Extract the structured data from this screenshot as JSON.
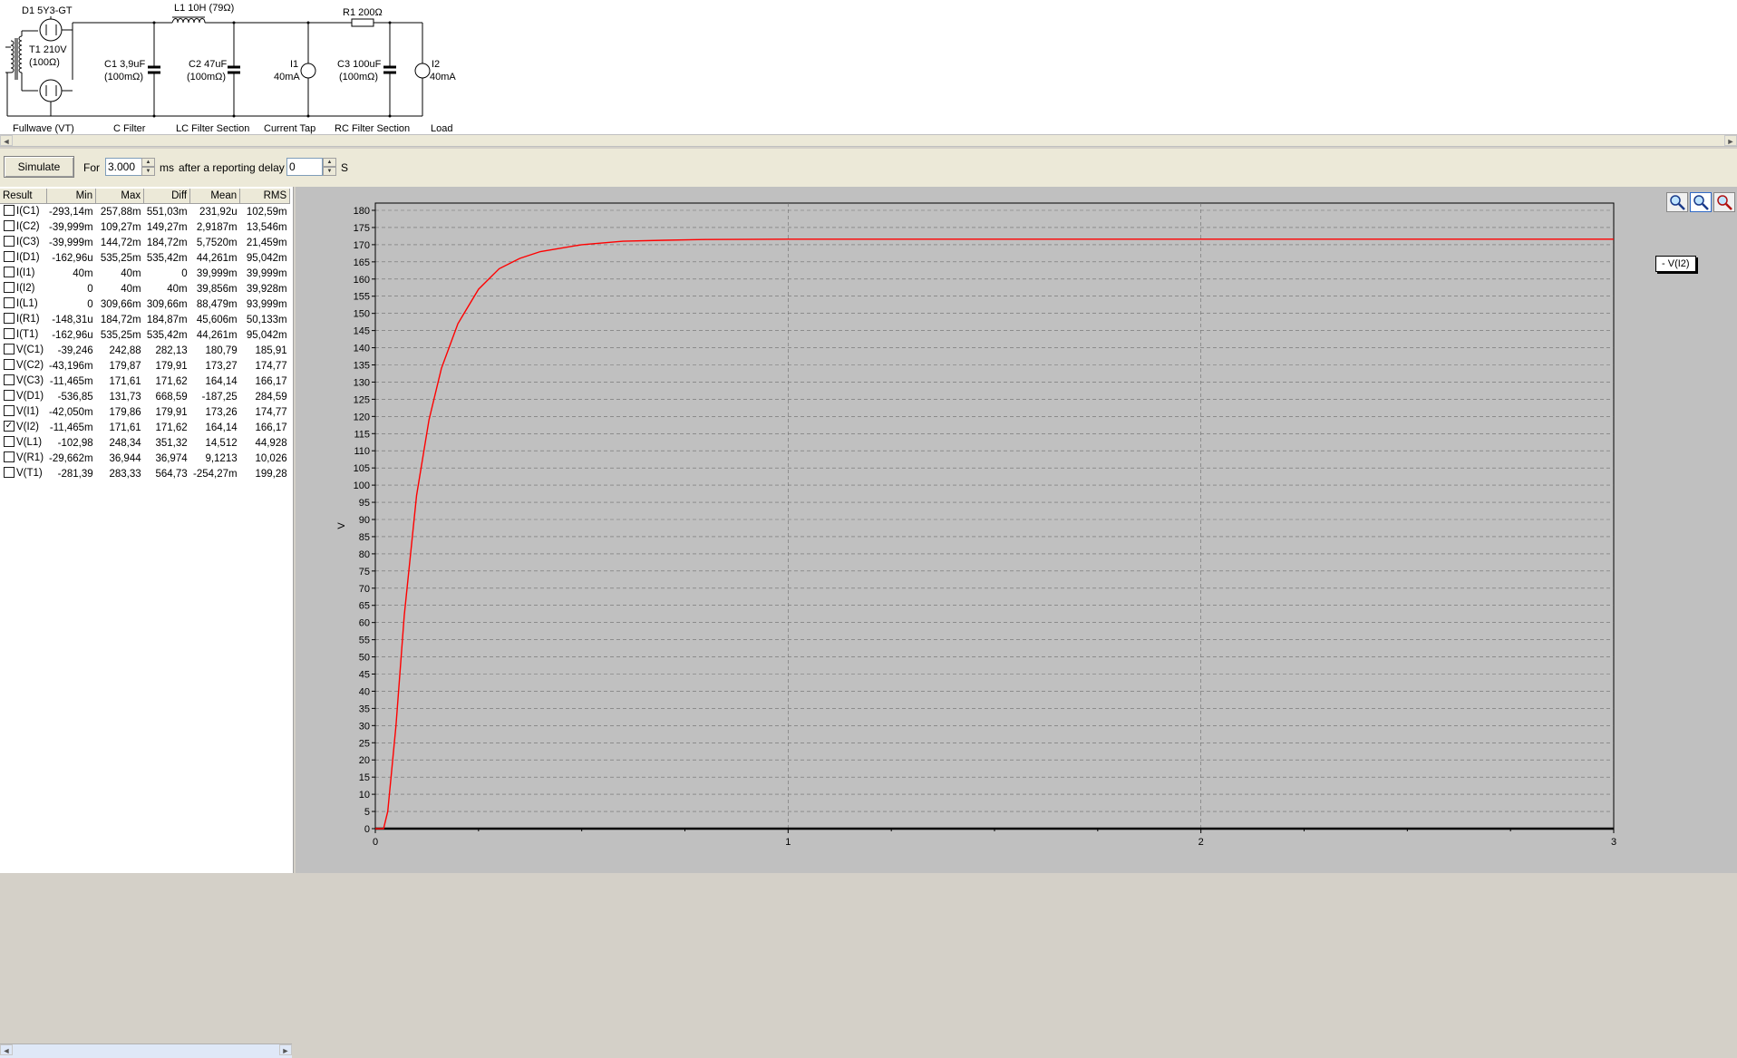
{
  "schematic": {
    "components": {
      "d1": "D1 5Y3-GT",
      "t1_line1": "T1 210V",
      "t1_line2": "(100Ω)",
      "l1": "L1 10H (79Ω)",
      "r1": "R1 200Ω",
      "c1_line1": "C1 3,9uF",
      "c1_line2": "(100mΩ)",
      "c2_line1": "C2 47uF",
      "c2_line2": "(100mΩ)",
      "i1_line1": "I1",
      "i1_line2": "40mA",
      "c3_line1": "C3 100uF",
      "c3_line2": "(100mΩ)",
      "i2_line1": "I2",
      "i2_line2": "40mA"
    },
    "sections": [
      "Fullwave (VT)",
      "C Filter",
      "LC Filter Section",
      "Current Tap",
      "RC Filter Section",
      "Load"
    ]
  },
  "toolbar": {
    "simulate_label": "Simulate",
    "for_label": "For",
    "duration_value": "3.000",
    "duration_unit": "ms",
    "delay_label": "after a reporting delay of",
    "delay_value": "0",
    "delay_unit": "S"
  },
  "results": {
    "headers": [
      "Result",
      "Min",
      "Max",
      "Diff",
      "Mean",
      "RMS"
    ],
    "rows": [
      {
        "name": "I(C1)",
        "checked": false,
        "min": "-293,14m",
        "max": "257,88m",
        "diff": "551,03m",
        "mean": "231,92u",
        "rms": "102,59m"
      },
      {
        "name": "I(C2)",
        "checked": false,
        "min": "-39,999m",
        "max": "109,27m",
        "diff": "149,27m",
        "mean": "2,9187m",
        "rms": "13,546m"
      },
      {
        "name": "I(C3)",
        "checked": false,
        "min": "-39,999m",
        "max": "144,72m",
        "diff": "184,72m",
        "mean": "5,7520m",
        "rms": "21,459m"
      },
      {
        "name": "I(D1)",
        "checked": false,
        "min": "-162,96u",
        "max": "535,25m",
        "diff": "535,42m",
        "mean": "44,261m",
        "rms": "95,042m"
      },
      {
        "name": "I(I1)",
        "checked": false,
        "min": "40m",
        "max": "40m",
        "diff": "0",
        "mean": "39,999m",
        "rms": "39,999m"
      },
      {
        "name": "I(I2)",
        "checked": false,
        "min": "0",
        "max": "40m",
        "diff": "40m",
        "mean": "39,856m",
        "rms": "39,928m"
      },
      {
        "name": "I(L1)",
        "checked": false,
        "min": "0",
        "max": "309,66m",
        "diff": "309,66m",
        "mean": "88,479m",
        "rms": "93,999m"
      },
      {
        "name": "I(R1)",
        "checked": false,
        "min": "-148,31u",
        "max": "184,72m",
        "diff": "184,87m",
        "mean": "45,606m",
        "rms": "50,133m"
      },
      {
        "name": "I(T1)",
        "checked": false,
        "min": "-162,96u",
        "max": "535,25m",
        "diff": "535,42m",
        "mean": "44,261m",
        "rms": "95,042m"
      },
      {
        "name": "V(C1)",
        "checked": false,
        "min": "-39,246",
        "max": "242,88",
        "diff": "282,13",
        "mean": "180,79",
        "rms": "185,91"
      },
      {
        "name": "V(C2)",
        "checked": false,
        "min": "-43,196m",
        "max": "179,87",
        "diff": "179,91",
        "mean": "173,27",
        "rms": "174,77"
      },
      {
        "name": "V(C3)",
        "checked": false,
        "min": "-11,465m",
        "max": "171,61",
        "diff": "171,62",
        "mean": "164,14",
        "rms": "166,17"
      },
      {
        "name": "V(D1)",
        "checked": false,
        "min": "-536,85",
        "max": "131,73",
        "diff": "668,59",
        "mean": "-187,25",
        "rms": "284,59"
      },
      {
        "name": "V(I1)",
        "checked": false,
        "min": "-42,050m",
        "max": "179,86",
        "diff": "179,91",
        "mean": "173,26",
        "rms": "174,77"
      },
      {
        "name": "V(I2)",
        "checked": true,
        "min": "-11,465m",
        "max": "171,61",
        "diff": "171,62",
        "mean": "164,14",
        "rms": "166,17"
      },
      {
        "name": "V(L1)",
        "checked": false,
        "min": "-102,98",
        "max": "248,34",
        "diff": "351,32",
        "mean": "14,512",
        "rms": "44,928"
      },
      {
        "name": "V(R1)",
        "checked": false,
        "min": "-29,662m",
        "max": "36,944",
        "diff": "36,974",
        "mean": "9,1213",
        "rms": "10,026"
      },
      {
        "name": "V(T1)",
        "checked": false,
        "min": "-281,39",
        "max": "283,33",
        "diff": "564,73",
        "mean": "-254,27m",
        "rms": "199,28"
      }
    ]
  },
  "chart_data": {
    "type": "line",
    "ylabel": "V",
    "xlabel": "",
    "xlim": [
      0,
      3
    ],
    "ylim": [
      0,
      180
    ],
    "x_ticks": [
      "0",
      "1",
      "2",
      "3"
    ],
    "y_tick_step": 5,
    "grid": true,
    "legend_position": "right",
    "series": [
      {
        "name": "V(I2)",
        "color": "#ff0000",
        "x": [
          0,
          0.02,
          0.03,
          0.05,
          0.07,
          0.1,
          0.13,
          0.16,
          0.2,
          0.25,
          0.3,
          0.35,
          0.4,
          0.5,
          0.6,
          0.7,
          0.8,
          1.0,
          1.5,
          2.0,
          2.5,
          3.0
        ],
        "y": [
          0,
          0,
          5,
          30,
          62,
          97,
          119,
          134,
          147,
          157,
          163,
          166,
          168,
          170,
          171,
          171.3,
          171.5,
          171.6,
          171.6,
          171.6,
          171.6,
          171.6
        ]
      }
    ]
  },
  "colors": {
    "plot_background": "#c0c0c0",
    "trace": "#ff0000",
    "window_face": "#ece9d8"
  }
}
